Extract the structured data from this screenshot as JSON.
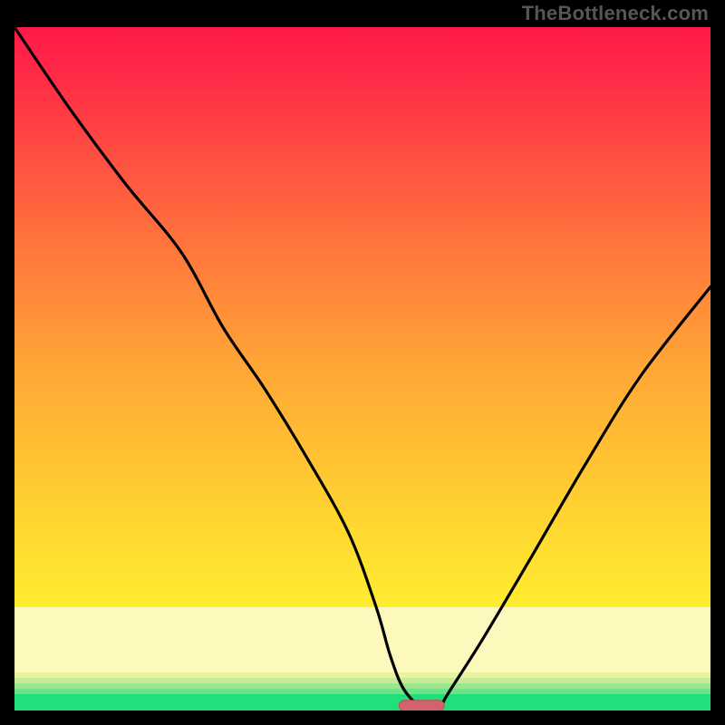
{
  "attribution": "TheBottleneck.com",
  "colors": {
    "top": "#ff1a49",
    "mid_upper": "#ff8a3a",
    "mid": "#ffe330",
    "lower_pale": "#fff9b8",
    "bottom": "#21e07c",
    "curve": "#000000",
    "pill_fill": "#d2626b",
    "pill_stroke": "#bb4f58"
  },
  "chart_data": {
    "type": "line",
    "title": "",
    "xlabel": "",
    "ylabel": "",
    "xlim": [
      0,
      100
    ],
    "ylim": [
      0,
      100
    ],
    "series": [
      {
        "name": "bottleneck-curve",
        "x": [
          0,
          8,
          16,
          24,
          30,
          36,
          42,
          48,
          52,
          54,
          56,
          59,
          61,
          62,
          67,
          74,
          82,
          90,
          100
        ],
        "y": [
          100,
          88,
          77,
          67,
          56,
          47,
          37,
          26,
          15,
          8,
          3,
          0,
          0,
          2,
          10,
          22,
          36,
          49,
          62
        ]
      }
    ],
    "annotations": [
      {
        "type": "pill",
        "x_center": 58.5,
        "y": 0.7,
        "width_pct": 6.5
      }
    ]
  }
}
